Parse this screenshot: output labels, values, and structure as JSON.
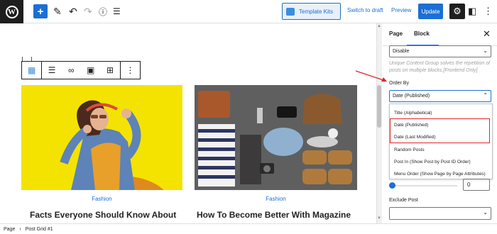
{
  "topbar": {
    "template_kits": "Template Kits",
    "switch_to_draft": "Switch to draft",
    "preview": "Preview",
    "update": "Update"
  },
  "posts": [
    {
      "category": "Fashion",
      "title": "Facts Everyone Should Know About"
    },
    {
      "category": "Fashion",
      "title": "How To Become Better With Magazine"
    }
  ],
  "sidebar": {
    "tabs": [
      "Page",
      "Block"
    ],
    "active_tab": "Block",
    "unique_group_value": "Disable",
    "unique_group_help": "Unique Content Group solves the repetition of posts on multiple blocks.[Frontend Only]",
    "order_by_label": "Order By",
    "order_by_value": "Date (Published)",
    "order_by_options": [
      "Title (Alphabetical)",
      "Date (Published)",
      "Date (Last Modified)",
      "Random Posts",
      "Post In (Show Post by Post ID Order)",
      "Menu Order (Show Page by Page Attributes)"
    ],
    "range_value": "0",
    "exclude_post_label": "Exclude Post"
  },
  "breadcrumb": {
    "items": [
      "Page",
      "Post Grid #1"
    ]
  },
  "colors": {
    "accent": "#1c6fd5",
    "highlight_box": "#e0242a",
    "arrow": "#e0242a",
    "image1_bg": "#f4e300"
  }
}
